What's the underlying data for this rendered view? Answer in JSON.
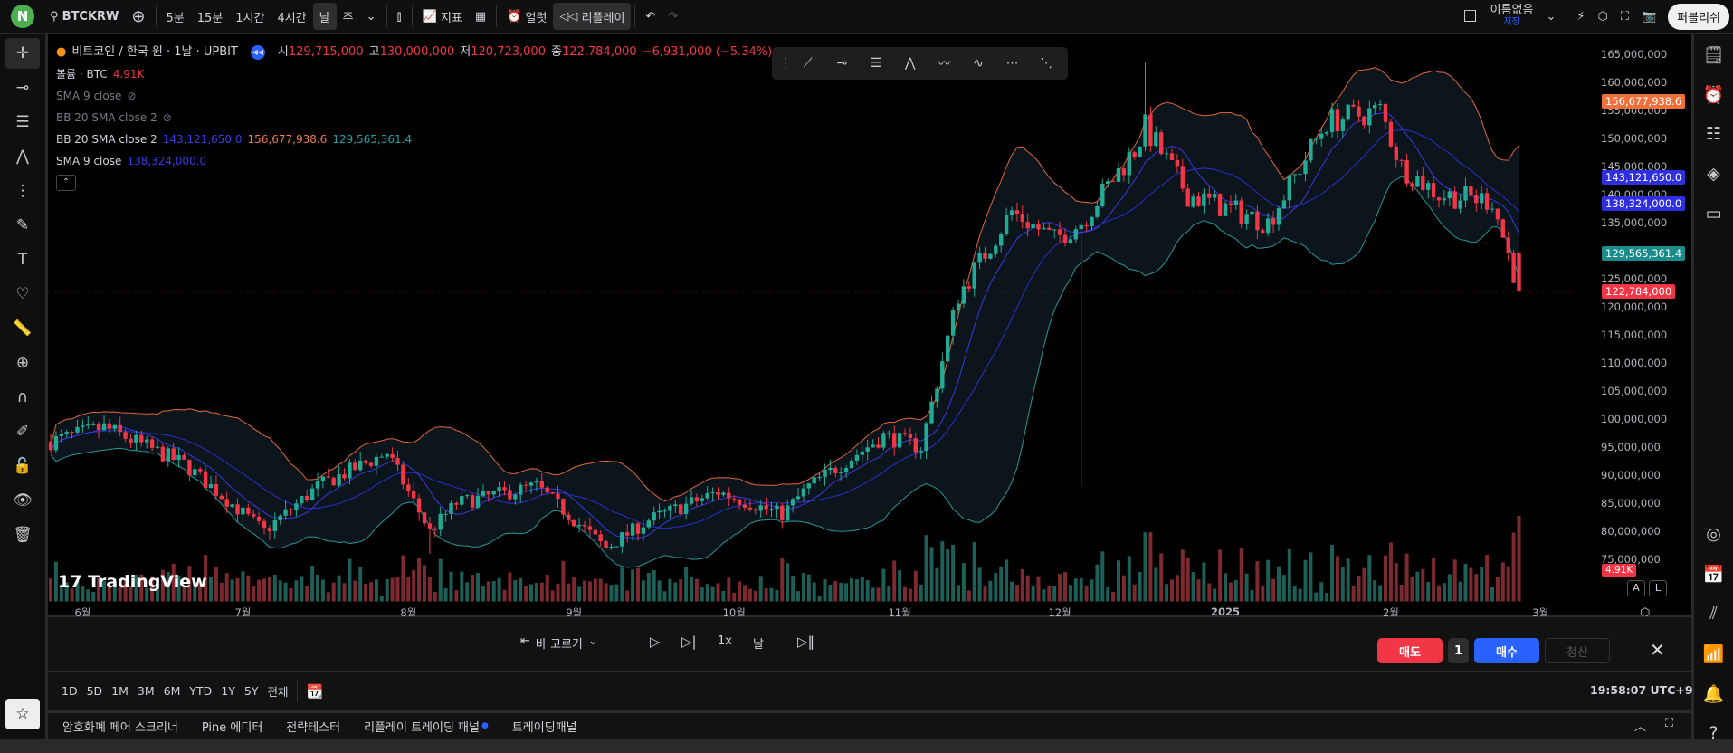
{
  "topbar": {
    "logo": "N",
    "symbol": "BTCKRW",
    "intervals": [
      "5분",
      "15분",
      "1시간",
      "4시간",
      "날",
      "주"
    ],
    "selected_interval": "날",
    "indicators": "지표",
    "alert": "얼럿",
    "replay": "리플레이",
    "layout_name": "이름없음",
    "save_status": "저장",
    "publish": "퍼블리쉬"
  },
  "legend": {
    "title": "비트코인 / 한국 원 · 1날 · UPBIT",
    "o_label": "시",
    "o": "129,715,000",
    "h_label": "고",
    "h": "130,000,000",
    "l_label": "저",
    "l": "120,723,000",
    "c_label": "종",
    "c": "122,784,000",
    "change": "−6,931,000 (−5.34%)",
    "volume_label": "볼륨 · BTC",
    "volume": "4.91K",
    "hidden1": "SMA 9 close",
    "hidden2": "BB 20 SMA close 2",
    "bb_label": "BB 20 SMA close 2",
    "bb_basis": "143,121,650.0",
    "bb_upper": "156,677,938.6",
    "bb_lower": "129,565,361.4",
    "sma_label": "SMA 9 close",
    "sma": "138,324,000.0"
  },
  "price_axis": {
    "labels": [
      "165,000,000",
      "160,000,000",
      "155,000,000",
      "150,000,000",
      "145,000,000",
      "140,000,000",
      "135,000,000",
      "130,000,000",
      "125,000,000",
      "120,000,000",
      "115,000,000",
      "110,000,000",
      "105,000,000",
      "100,000,000",
      "95,000,000",
      "90,000,000",
      "85,000,000",
      "80,000,000",
      "75,000,000"
    ],
    "badges": [
      {
        "text": "156,677,938.6",
        "value": 156677938.6,
        "color": "#f0703c"
      },
      {
        "text": "143,121,650.0",
        "value": 143121650,
        "color": "#2f2fe0"
      },
      {
        "text": "138,324,000.0",
        "value": 138324000,
        "color": "#2f2fe0"
      },
      {
        "text": "129,565,361.4",
        "value": 129565361.4,
        "color": "#1a8c8c"
      },
      {
        "text": "122,784,000",
        "value": 122784000,
        "color": "#f23645"
      }
    ],
    "volume_badge": "4.91K",
    "auto": "A",
    "log": "L"
  },
  "time_axis": {
    "labels": [
      {
        "text": "6월",
        "day": 6
      },
      {
        "text": "7월",
        "day": 36
      },
      {
        "text": "8월",
        "day": 67
      },
      {
        "text": "9월",
        "day": 98
      },
      {
        "text": "10월",
        "day": 128
      },
      {
        "text": "11월",
        "day": 159
      },
      {
        "text": "12월",
        "day": 189
      },
      {
        "text": "2025",
        "day": 220
      },
      {
        "text": "2월",
        "day": 251
      },
      {
        "text": "3월",
        "day": 279
      }
    ]
  },
  "chart_data": {
    "type": "candlestick",
    "start": "2024-05-26",
    "days": 276,
    "unit": "KRW (millions)",
    "ylim": [
      75,
      165
    ],
    "keypoints": [
      [
        0,
        96
      ],
      [
        10,
        98.5
      ],
      [
        25,
        92
      ],
      [
        40,
        80
      ],
      [
        50,
        88
      ],
      [
        63,
        94
      ],
      [
        71,
        80
      ],
      [
        76,
        85
      ],
      [
        91,
        88
      ],
      [
        104,
        77
      ],
      [
        112,
        82
      ],
      [
        125,
        87
      ],
      [
        137,
        83
      ],
      [
        142,
        88
      ],
      [
        156,
        97
      ],
      [
        163,
        95
      ],
      [
        170,
        122
      ],
      [
        180,
        137
      ],
      [
        188,
        132
      ],
      [
        193,
        135
      ],
      [
        203,
        148
      ],
      [
        205,
        152
      ],
      [
        213,
        140
      ],
      [
        228,
        135
      ],
      [
        239,
        153
      ],
      [
        249,
        155
      ],
      [
        253,
        145
      ],
      [
        260,
        140
      ],
      [
        270,
        139
      ],
      [
        275,
        122.8
      ]
    ],
    "last": {
      "open": 129.715,
      "high": 130.0,
      "low": 120.723,
      "close": 122.784
    }
  },
  "watermark": "TradingView",
  "replay": {
    "select_bar": "바 고르기",
    "speed": "1x",
    "interval": "날",
    "sell": "매도",
    "qty": "1",
    "buy": "매수",
    "close": "청산"
  },
  "ranges": [
    "1D",
    "5D",
    "1M",
    "3M",
    "6M",
    "YTD",
    "1Y",
    "5Y",
    "전체"
  ],
  "clock": "19:58:07 UTC+9",
  "tabs": [
    "암호화폐 페어 스크리너",
    "Pine 에디터",
    "전략테스터",
    "리플레이 트레이딩 패널",
    "트레이딩패널"
  ],
  "colors": {
    "up": "#22ab94",
    "down": "#f23645",
    "upper": "#e0683a",
    "lower": "#2a9696",
    "basis": "#2e2ed0",
    "sma": "#3a3ae0"
  }
}
